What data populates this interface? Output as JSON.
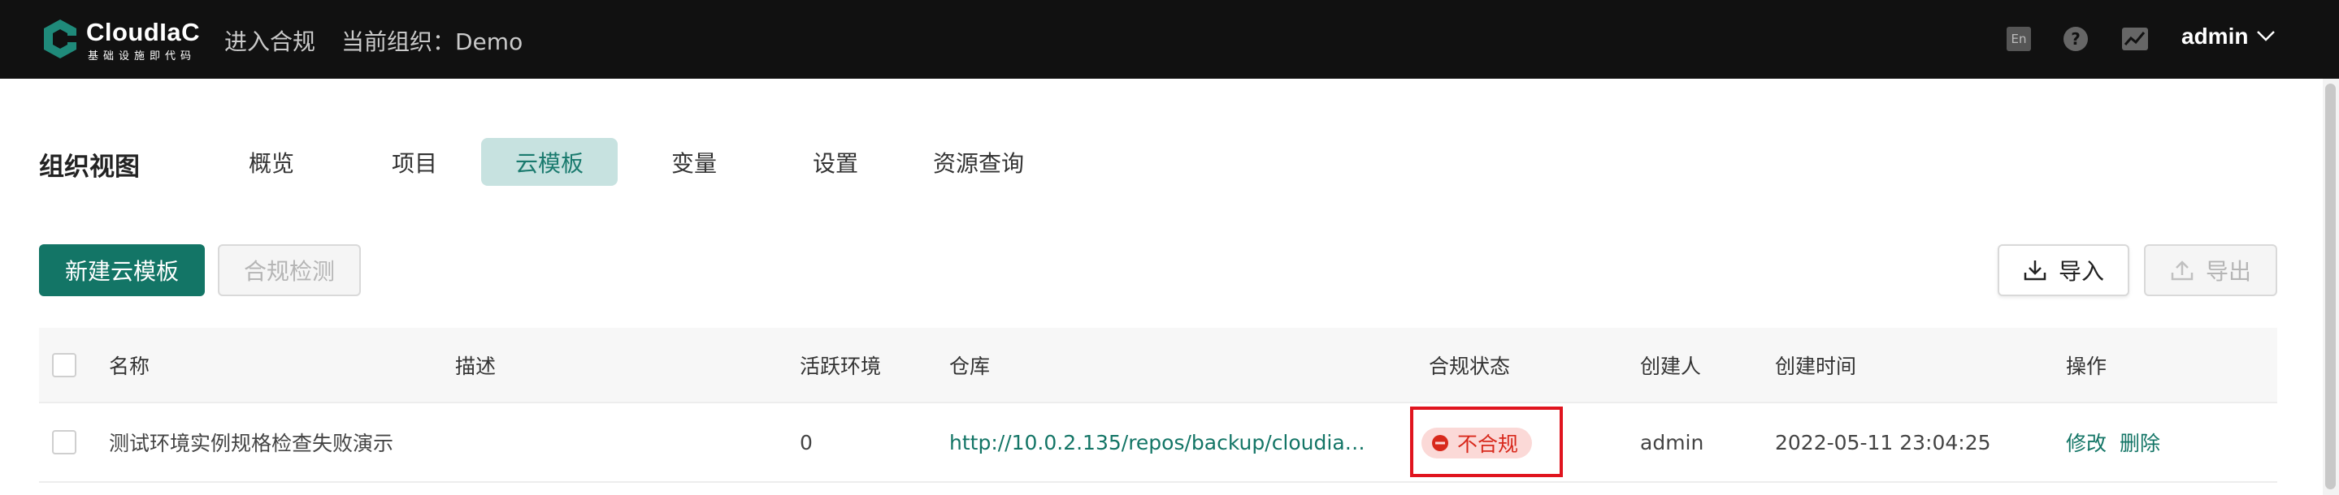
{
  "header": {
    "logo_name": "CloudIaC",
    "logo_sub": "基础设施即代码",
    "enter_compliance": "进入合规",
    "current_org_label": "当前组织：Demo",
    "lang_icon": "En",
    "user": "admin"
  },
  "org_nav": {
    "title": "组织视图",
    "tabs": [
      {
        "label": "概览"
      },
      {
        "label": "项目"
      },
      {
        "label": "云模板",
        "active": true
      },
      {
        "label": "变量"
      },
      {
        "label": "设置"
      },
      {
        "label": "资源查询"
      }
    ]
  },
  "actions": {
    "create_label": "新建云模板",
    "compliance_check_label": "合规检测",
    "import_label": "导入",
    "export_label": "导出"
  },
  "table": {
    "columns": [
      "名称",
      "描述",
      "活跃环境",
      "仓库",
      "合规状态",
      "创建人",
      "创建时间",
      "操作"
    ],
    "rows": [
      {
        "name": "测试环境实例规格检查失败演示",
        "description": "",
        "active_envs": "0",
        "repo": "http://10.0.2.135/repos/backup/cloudiac/clou...",
        "compliance_status": "不合规",
        "creator": "admin",
        "created_at": "2022-05-11 23:04:25",
        "ops": [
          "修改",
          "删除"
        ]
      }
    ]
  },
  "colors": {
    "header_bg": "#111111",
    "primary": "#137566",
    "active_tab_bg": "#c7e2e0",
    "danger": "#e0141e",
    "badge_bg": "#fbd9d7"
  },
  "icons": {
    "logo": "cloudiac-logo-icon",
    "help": "question-circle-icon",
    "stats": "line-chart-icon",
    "user_menu": "chevron-down-icon",
    "import": "download-icon",
    "export": "upload-icon",
    "status": "minus-circle-icon"
  }
}
